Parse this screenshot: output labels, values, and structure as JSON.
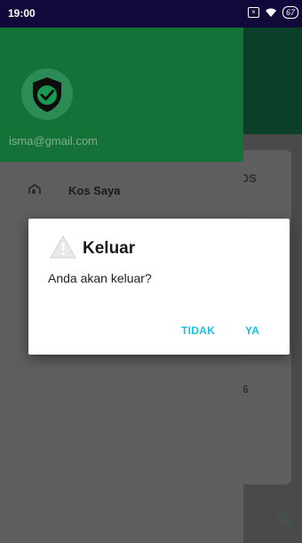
{
  "status_bar": {
    "time": "19:00",
    "battery": "67"
  },
  "drawer": {
    "email": "isma@gmail.com",
    "items": [
      {
        "label": "Kos Saya",
        "icon": "home-icon"
      }
    ]
  },
  "underlay": {
    "card_fragment": "OS",
    "fragment_6": "6"
  },
  "dialog": {
    "title": "Keluar",
    "message": "Anda akan keluar?",
    "icon": "warning-icon",
    "no_label": "TIDAK",
    "yes_label": "YA"
  },
  "colors": {
    "status_bar": "#11093a",
    "drawer_header": "#147239",
    "accent": "#19c2e0"
  }
}
